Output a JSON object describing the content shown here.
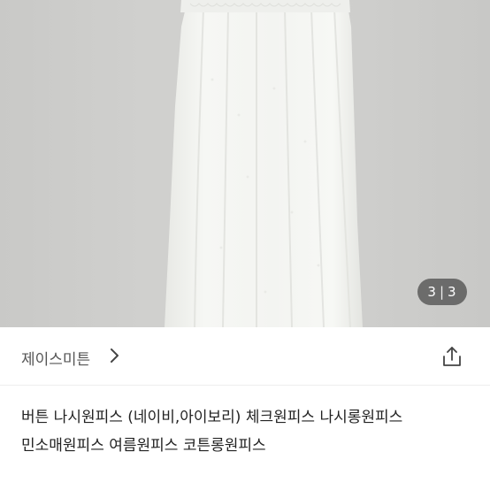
{
  "product": {
    "image_counter": {
      "current": "3",
      "separator": "|",
      "total": "3"
    },
    "seller": {
      "name": "제이스미튼"
    },
    "title": "버튼 나시원피스 (네이비,아이보리) 체크원피스 나시롱원피스 민소매원피스 여름원피스 코튼롱원피스"
  },
  "icons": {
    "seller_chevron": "chevron-right-icon",
    "share": "share-icon"
  },
  "colors": {
    "background_wall": "#cfcfcd",
    "dress": "#f4f5f2",
    "counter_bg": "#464646",
    "text_primary": "#222222",
    "text_secondary": "#555555"
  }
}
